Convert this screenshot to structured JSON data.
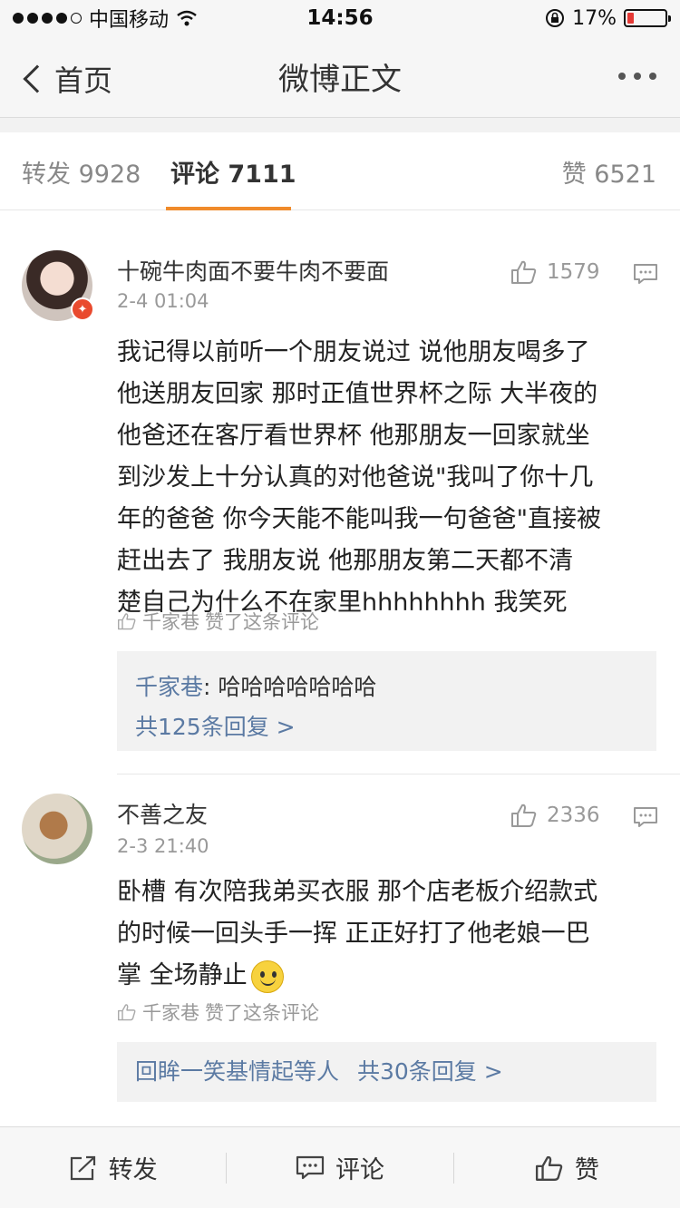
{
  "status_bar": {
    "carrier": "中国移动",
    "time": "14:56",
    "battery_text": "17%",
    "battery_level": 0.17,
    "battery_color": "#e53935"
  },
  "nav": {
    "back_label": "首页",
    "title": "微博正文"
  },
  "tabs": [
    {
      "label": "转发 9928",
      "active": false
    },
    {
      "label": "评论 7111",
      "active": true
    },
    {
      "label": "赞 6521",
      "active": false
    }
  ],
  "accent_color": "#f08b2b",
  "link_color": "#5b7aa3",
  "comments": [
    {
      "name": "十碗牛肉面不要牛肉不要面",
      "time": "2-4 01:04",
      "likes": "1579",
      "lines": [
        "我记得以前听一个朋友说过  说他朋友喝多了",
        "他送朋友回家  那时正值世界杯之际  大半夜的",
        "他爸还在客厅看世界杯  他那朋友一回家就坐",
        "到沙发上十分认真的对他爸说\"我叫了你十几",
        "年的爸爸  你今天能不能叫我一句爸爸\"直接被",
        "赶出去了   我朋友说  他那朋友第二天都不清",
        "楚自己为什么不在家里hhhhhhhh  我笑死"
      ],
      "liked_by": "千家巷",
      "liked_text": "赞了这条评论",
      "reply_author": "千家巷",
      "reply_text": ": 哈哈哈哈哈哈哈",
      "reply_count": "共125条回复 >"
    },
    {
      "name": "不善之友",
      "time": "2-3 21:40",
      "likes": "2336",
      "lines": [
        "卧槽  有次陪我弟买衣服  那个店老板介绍款式",
        "的时候一回头手一挥  正正好打了他老娘一巴",
        "掌  全场静止"
      ],
      "emoji": "smiley-icon",
      "liked_by": "千家巷",
      "liked_text": "赞了这条评论",
      "reply_author": "回眸一笑基情起等人",
      "reply_count": "共30条回复 >"
    }
  ],
  "bottom_bar": {
    "repost_label": "转发",
    "comment_label": "评论",
    "like_label": "赞"
  }
}
